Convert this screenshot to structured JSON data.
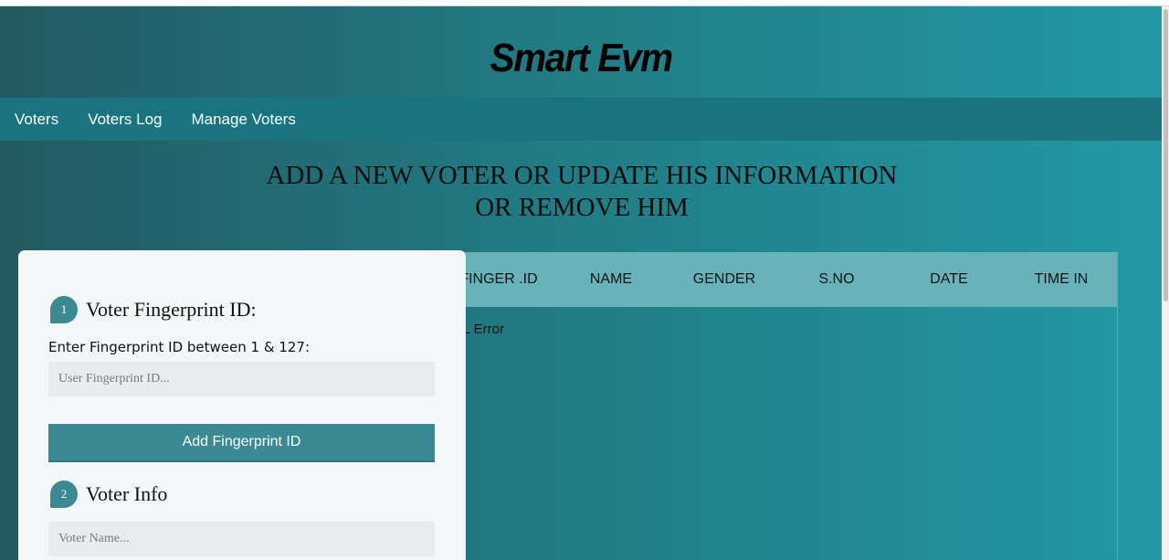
{
  "brand": {
    "title": "Smart Evm"
  },
  "nav": {
    "items": [
      "Voters",
      "Voters Log",
      "Manage Voters"
    ]
  },
  "heading": {
    "line1": "ADD A NEW VOTER OR UPDATE HIS INFORMATION",
    "line2": "OR REMOVE HIM"
  },
  "form": {
    "step1": {
      "number": "1",
      "title": "Voter Fingerprint ID:"
    },
    "fingerprint_label": "Enter Fingerprint ID between 1 & 127:",
    "fingerprint_placeholder": "User Fingerprint ID...",
    "add_button": "Add Fingerprint ID",
    "step2": {
      "number": "2",
      "title": "Voter Info"
    },
    "name_placeholder": "Voter Name..."
  },
  "table": {
    "columns": [
      "FINGER .ID",
      "NAME",
      "GENDER",
      "S.NO",
      "DATE",
      "TIME IN"
    ],
    "error_text": "SQL Error"
  },
  "colors": {
    "accent": "#3a8a93",
    "nav_bg": "#1a747f",
    "table_header_bg": "#67b3b9"
  }
}
